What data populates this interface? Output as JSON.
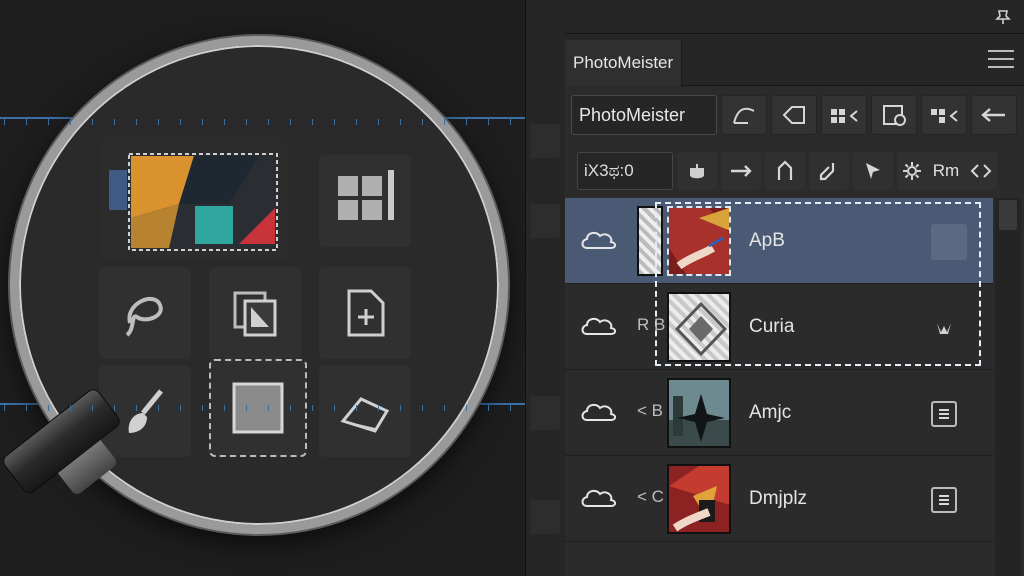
{
  "panel": {
    "tab_label": "PhotoMeister",
    "name_field_value": "PhotoMeister",
    "coord_field_value": "iX3ಥ:0",
    "rm_label": "Rm"
  },
  "layers": [
    {
      "prefix": "",
      "name": "ApB",
      "selected": true
    },
    {
      "prefix": "R B",
      "name": "Curia",
      "selected": false
    },
    {
      "prefix": "< B",
      "name": "Amjc",
      "selected": false
    },
    {
      "prefix": "< C",
      "name": "Dmjplz",
      "selected": false
    }
  ],
  "icons": {
    "toolbar1": [
      "path-icon",
      "tag-icon",
      "grid-arrow-icon",
      "mask-icon",
      "grid-arrow-2-icon",
      "arrow-left-icon"
    ],
    "toolbar2": [
      "stamp-icon",
      "move-arrow-icon",
      "pen-icon",
      "eyedropper-icon",
      "cursor-icon",
      "gear-icon",
      "expand-icon"
    ],
    "magnifier": [
      "selection-thumbnail",
      "grid-icon",
      "brush-icon",
      "lasso-icon",
      "copy-layer-icon",
      "add-page-icon",
      "paint-brush-icon",
      "rectangle-icon",
      "eraser-icon"
    ]
  },
  "colors": {
    "selected_row": "#4a5a74",
    "guide_blue": "#3b6fa8",
    "panel_bg": "#2b2b2b"
  }
}
